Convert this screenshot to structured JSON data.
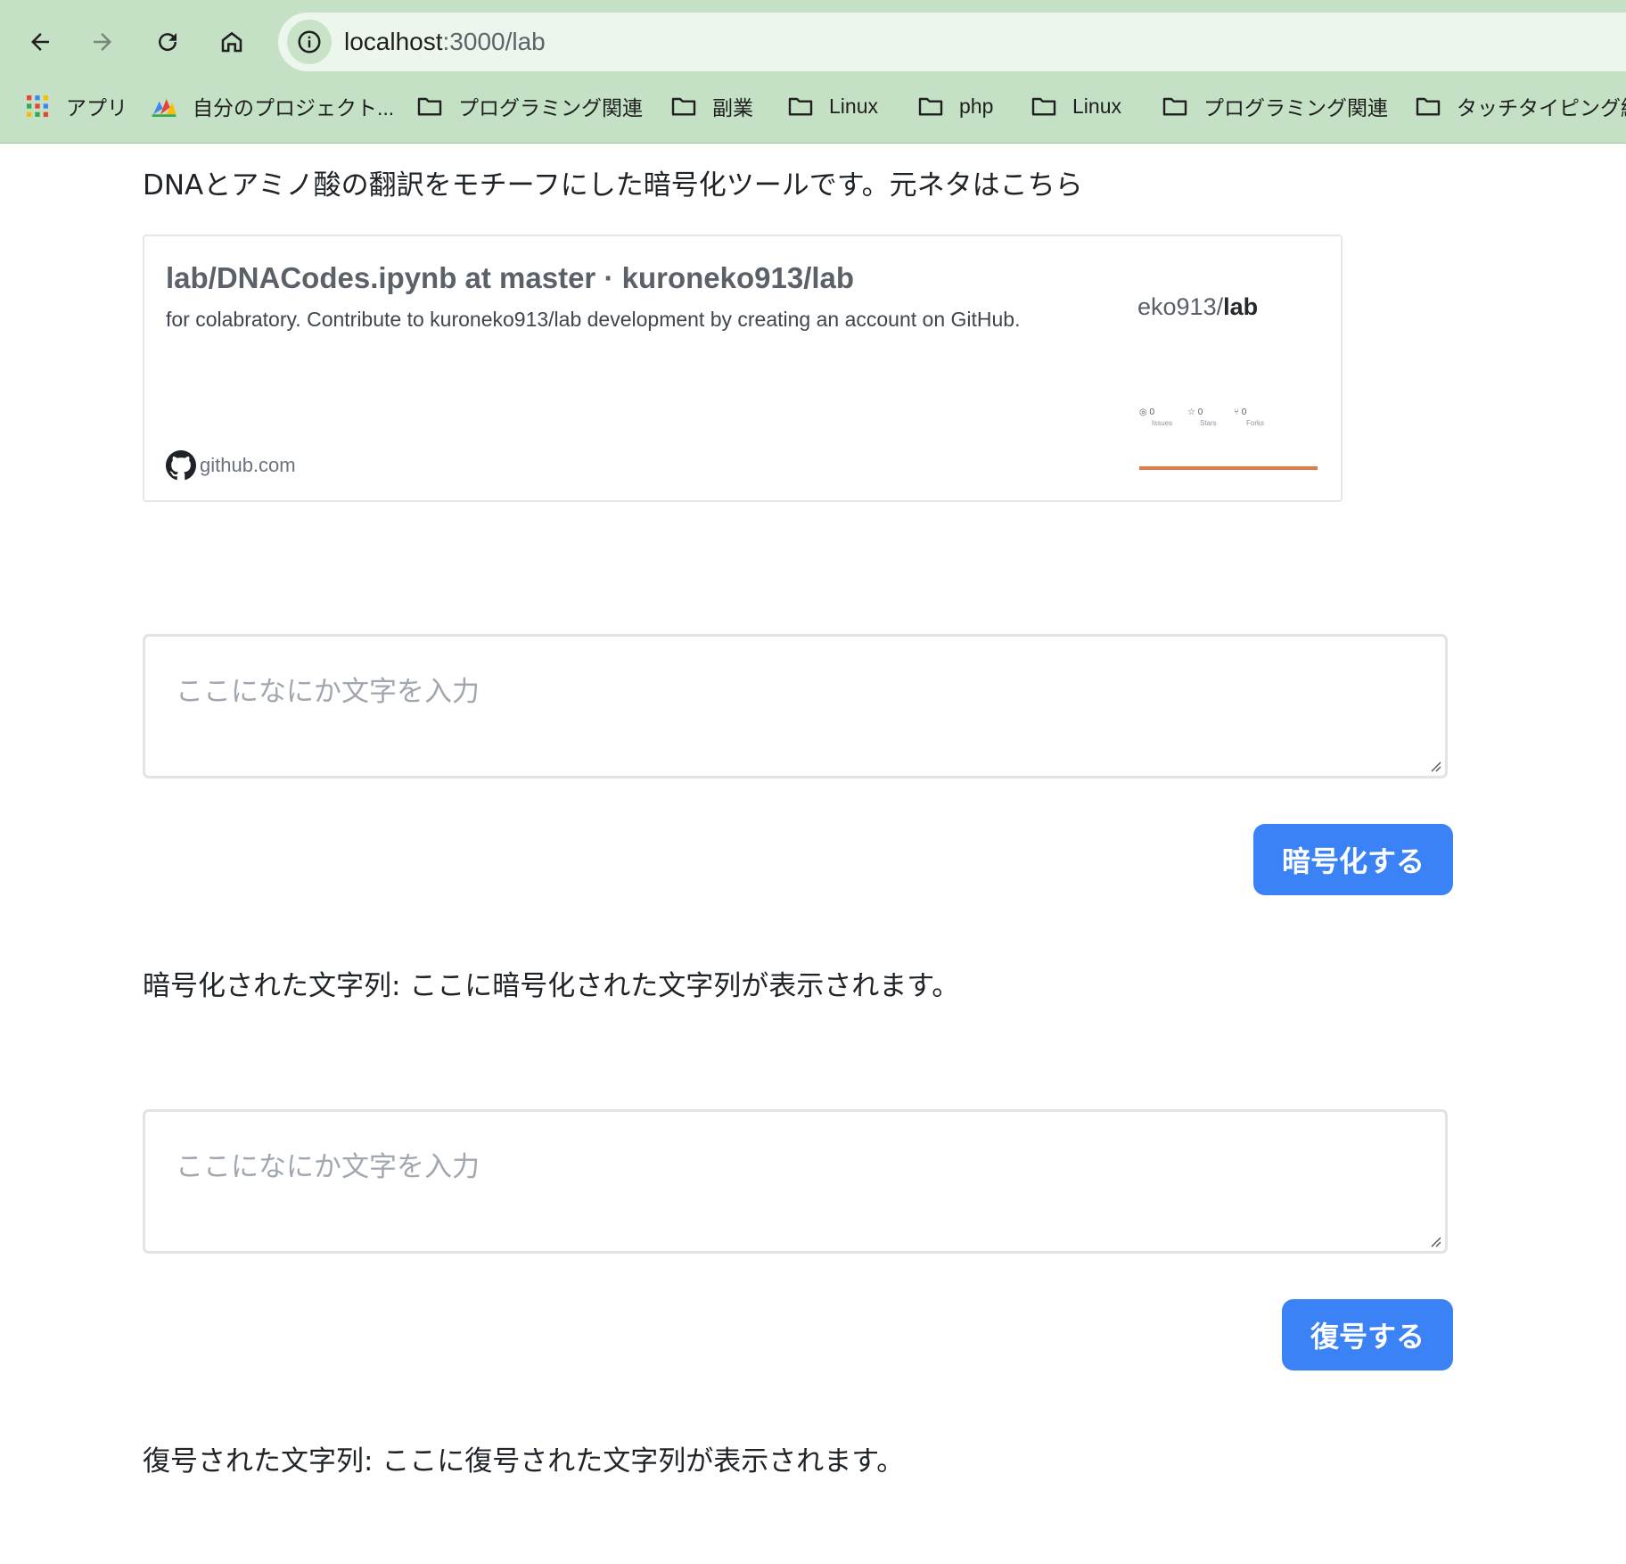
{
  "browser": {
    "url_host": "localhost",
    "url_path": ":3000/lab",
    "bookmarks": [
      {
        "label": "アプリ",
        "icon": "apps-grid-icon"
      },
      {
        "label": "自分のプロジェクト...",
        "icon": "project-icon"
      },
      {
        "label": "プログラミング関連",
        "icon": "folder-icon"
      },
      {
        "label": "副業",
        "icon": "folder-icon"
      },
      {
        "label": "Linux",
        "icon": "folder-icon"
      },
      {
        "label": "php",
        "icon": "folder-icon"
      },
      {
        "label": "Linux",
        "icon": "folder-icon"
      },
      {
        "label": "プログラミング関連",
        "icon": "folder-icon"
      },
      {
        "label": "タッチタイピング練",
        "icon": "folder-icon"
      }
    ]
  },
  "page": {
    "intro": "DNAとアミノ酸の翻訳をモチーフにした暗号化ツールです。元ネタはこちら",
    "link_card": {
      "title": "lab/DNACodes.ipynb at master · kuroneko913/lab",
      "description": "for colabratory. Contribute to kuroneko913/lab development by creating an account on GitHub.",
      "domain": "github.com",
      "thumb_owner": "eko913/",
      "thumb_repo": "lab",
      "stats": [
        {
          "count": "0",
          "label": "Issues",
          "icon": "issue-icon"
        },
        {
          "count": "0",
          "label": "Stars",
          "icon": "star-icon"
        },
        {
          "count": "0",
          "label": "Forks",
          "icon": "fork-icon"
        }
      ],
      "accent_color": "#e07a46"
    },
    "encrypt": {
      "placeholder": "ここになにか文字を入力",
      "button": "暗号化する",
      "result_label": "暗号化された文字列: ",
      "result_value": "ここに暗号化された文字列が表示されます。"
    },
    "decrypt": {
      "placeholder": "ここになにか文字を入力",
      "button": "復号する",
      "result_label": "復号された文字列: ",
      "result_value": "ここに復号された文字列が表示されます。"
    },
    "button_color": "#3b82f6"
  }
}
